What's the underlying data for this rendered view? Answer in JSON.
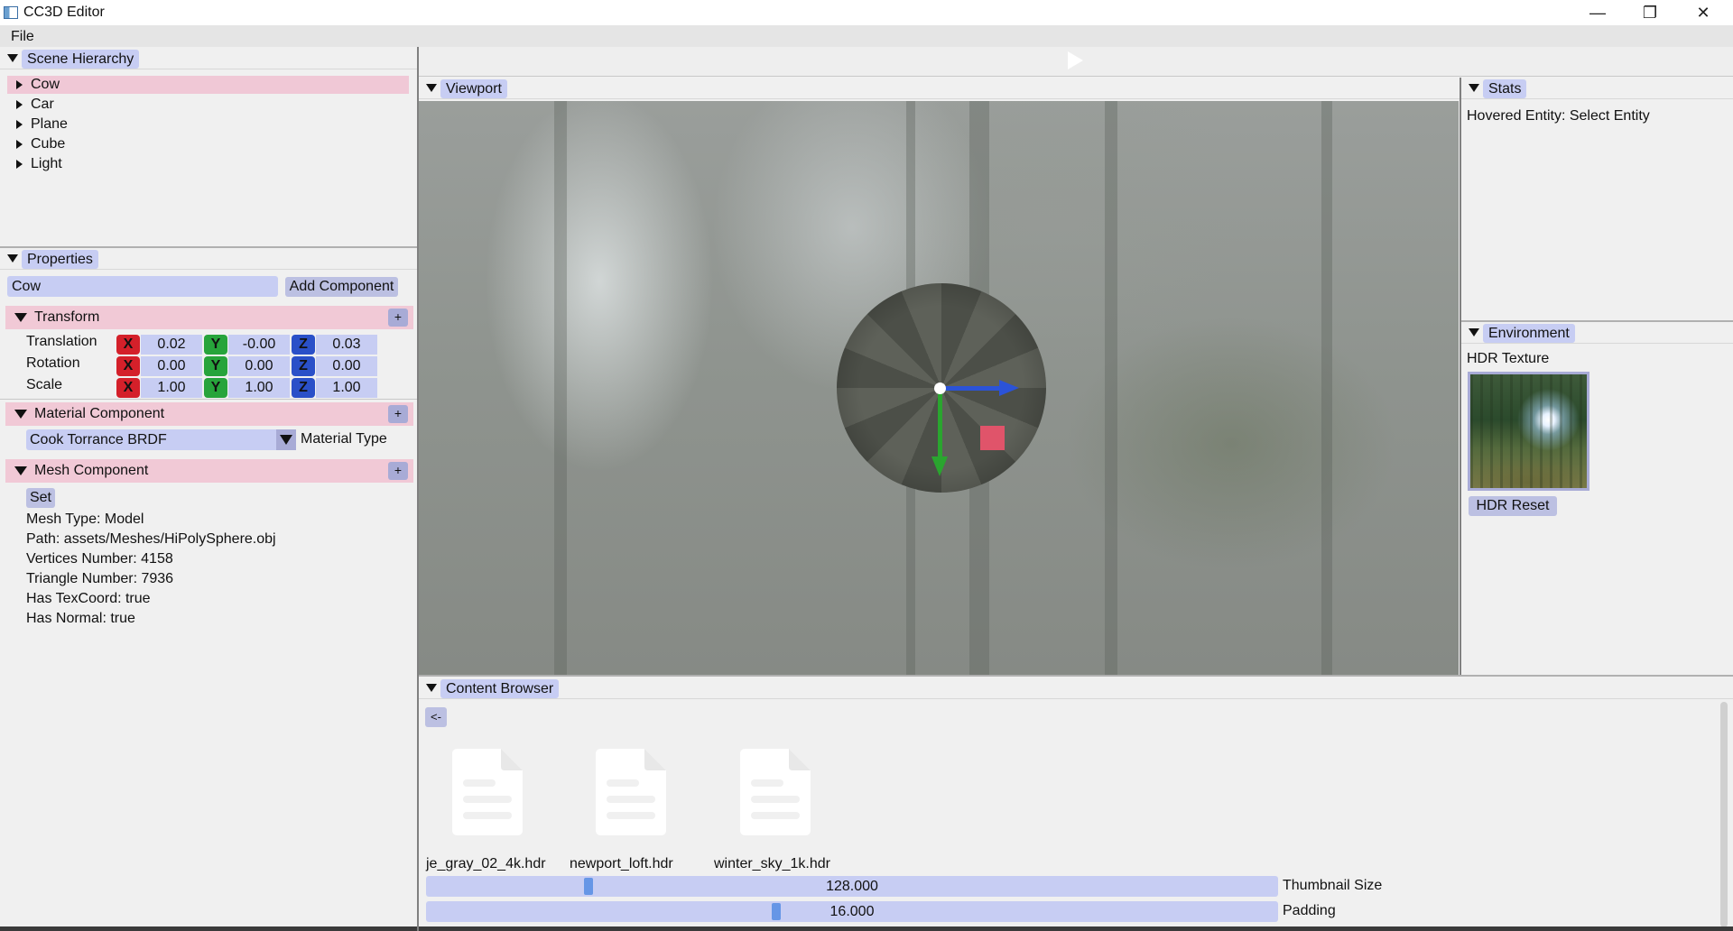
{
  "window": {
    "title": "CC3D Editor",
    "minimize_glyph": "—",
    "maximize_glyph": "❐",
    "close_glyph": "✕"
  },
  "menu": {
    "file": "File"
  },
  "toolbar": {
    "play_icon": "play-icon"
  },
  "hierarchy": {
    "tab": "Scene Hierarchy",
    "items": [
      {
        "label": "Cow",
        "selected": true
      },
      {
        "label": "Car"
      },
      {
        "label": "Plane"
      },
      {
        "label": "Cube"
      },
      {
        "label": "Light"
      }
    ]
  },
  "properties": {
    "tab": "Properties",
    "entity_name": "Cow",
    "add_component": "Add Component",
    "transform": {
      "title": "Transform",
      "plus": "+",
      "rows": [
        {
          "label": "Translation",
          "x": "0.02",
          "y": "-0.00",
          "z": "0.03"
        },
        {
          "label": "Rotation",
          "x": "0.00",
          "y": "0.00",
          "z": "0.00"
        },
        {
          "label": "Scale",
          "x": "1.00",
          "y": "1.00",
          "z": "1.00"
        }
      ],
      "axis_x": "X",
      "axis_y": "Y",
      "axis_z": "Z"
    },
    "material": {
      "title": "Material Component",
      "plus": "+",
      "selected": "Cook Torrance BRDF",
      "type_label": "Material Type"
    },
    "mesh": {
      "title": "Mesh Component",
      "plus": "+",
      "set_button": "Set",
      "lines": [
        "Mesh Type: Model",
        "Path: assets/Meshes/HiPolySphere.obj",
        "Vertices Number: 4158",
        "Triangle Number: 7936",
        "Has TexCoord: true",
        "Has Normal: true"
      ]
    }
  },
  "viewport": {
    "tab": "Viewport"
  },
  "stats": {
    "tab": "Stats",
    "hovered": "Hovered Entity: Select Entity"
  },
  "environment": {
    "tab": "Environment",
    "hdr_label": "HDR Texture",
    "reset_button": "HDR Reset"
  },
  "content_browser": {
    "tab": "Content Browser",
    "back_button": "<-",
    "files": [
      "je_gray_02_4k.hdr",
      "newport_loft.hdr",
      "winter_sky_1k.hdr"
    ],
    "thumbnail_size": {
      "value": "128.000",
      "label": "Thumbnail Size",
      "fraction": 0.187
    },
    "padding": {
      "value": "16.000",
      "label": "Padding",
      "fraction": 0.41
    }
  },
  "colors": {
    "accent": "#c7cdf3",
    "section_header": "#f1c9d6",
    "axis_x": "#d4202a",
    "axis_y": "#27a43b",
    "axis_z": "#2a50c8"
  }
}
